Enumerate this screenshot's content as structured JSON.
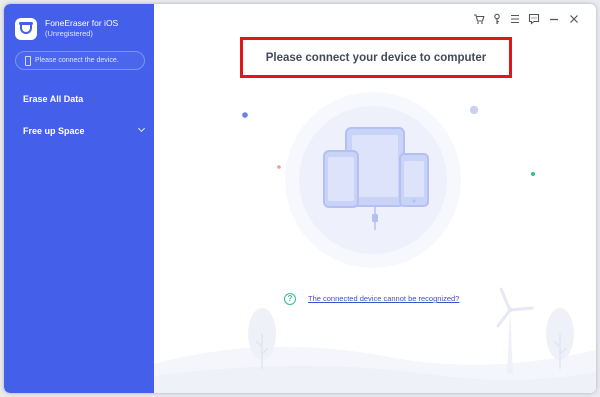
{
  "app": {
    "title": "FoneEraser for iOS",
    "subtitle": "(Unregistered)",
    "device_status": "Please connect the device."
  },
  "sidebar": {
    "items": [
      {
        "label": "Erase All Data"
      },
      {
        "label": "Free up Space"
      }
    ]
  },
  "toolbar": {
    "icons": [
      "cart-icon",
      "key-icon",
      "menu-icon",
      "feedback-icon",
      "minimize-icon",
      "close-icon"
    ]
  },
  "main": {
    "heading": "Please connect your device to computer",
    "help_link": "The connected device cannot be recognized?",
    "help_icon_glyph": "?"
  },
  "colors": {
    "sidebar": "#4460ea",
    "highlight_border": "#e0161b",
    "help_green": "#33c08a",
    "link": "#3a54c9"
  }
}
